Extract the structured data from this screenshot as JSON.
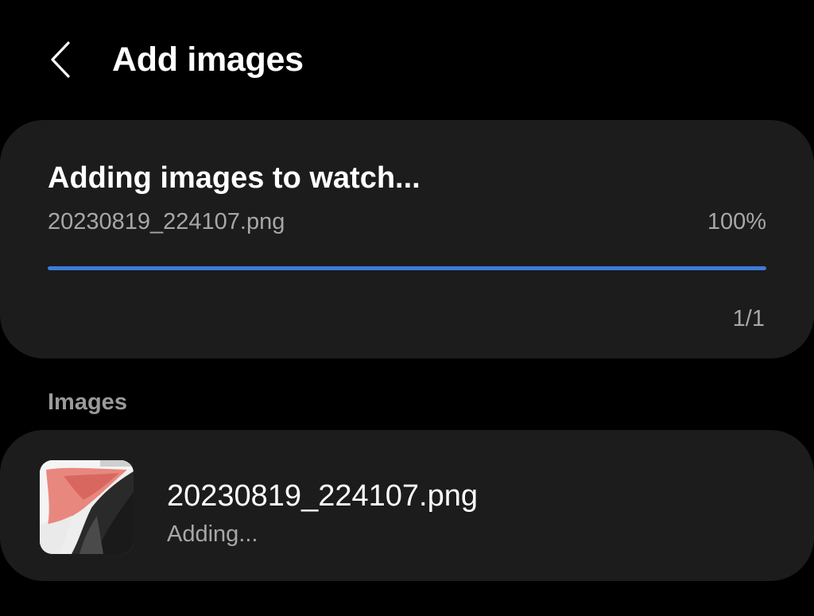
{
  "header": {
    "back_icon": "chevron-left-icon",
    "title": "Add images"
  },
  "progress": {
    "heading": "Adding images to watch...",
    "current_file": "20230819_224107.png",
    "percent_text": "100%",
    "percent_value": 1.0,
    "count": "1/1",
    "bar_color": "#3d7bdb",
    "track_color": "#3a3a3a"
  },
  "images_section": {
    "label": "Images",
    "items": [
      {
        "name": "20230819_224107.png",
        "status": "Adding...",
        "thumbnail_icon": "image-thumbnail"
      }
    ]
  },
  "colors": {
    "background": "#000000",
    "card": "#1c1c1c",
    "primary_text": "#ffffff",
    "secondary_text": "#a7a7a7",
    "accent": "#3d7bdb"
  }
}
